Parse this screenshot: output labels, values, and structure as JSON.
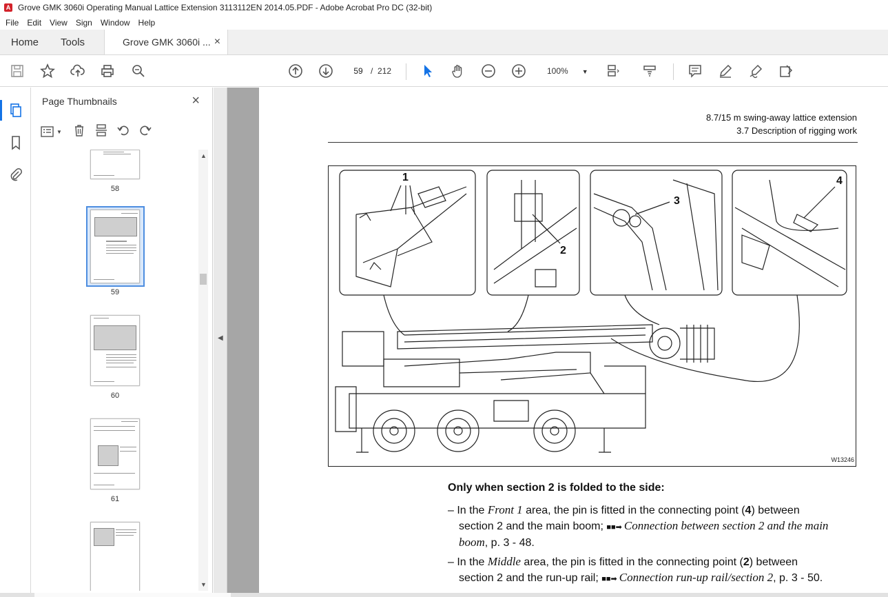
{
  "window": {
    "title": "Grove GMK 3060i Operating Manual Lattice Extension 3113112EN 2014.05.PDF - Adobe Acrobat Pro DC (32-bit)"
  },
  "menu": [
    "File",
    "Edit",
    "View",
    "Sign",
    "Window",
    "Help"
  ],
  "tabs": {
    "home": "Home",
    "tools": "Tools",
    "doc": "Grove GMK 3060i ...",
    "close": "×"
  },
  "toolbar": {
    "page_current": "59",
    "page_sep": "/",
    "page_total": "212",
    "zoom": "100%"
  },
  "panel": {
    "title": "Page Thumbnails",
    "close": "×",
    "thumb_labels": [
      "58",
      "59",
      "60",
      "61"
    ]
  },
  "page": {
    "header_line1": "8.7/15 m swing-away lattice extension",
    "header_line2": "3.7 Description of rigging work",
    "figure_id": "W13246",
    "callouts": [
      "1",
      "2",
      "3",
      "4"
    ],
    "heading": "Only when section 2 is folded to the side:",
    "item1": {
      "prefix": "– In the ",
      "area": "Front 1",
      "mid": " area, the pin is fitted in the connecting point (",
      "num": "4",
      "after": ") between",
      "line2_start": "section 2 and the main boom; ",
      "link": "Connection between section 2 and the main",
      "line3_link": "boom",
      "line3_end": ", p. 3 - 48."
    },
    "item2": {
      "prefix": "– In the ",
      "area": "Middle",
      "mid": " area, the pin is fitted in the connecting point (",
      "num": "2",
      "after": ") between",
      "line2_start": "section 2 and the run-up rail; ",
      "link": "Connection run-up rail/section 2",
      "line2_end": ", p. 3 - 50."
    }
  },
  "colors": {
    "accent": "#1473e6",
    "app_icon": "#d3222a",
    "doc_bg": "#a6a6a6"
  }
}
